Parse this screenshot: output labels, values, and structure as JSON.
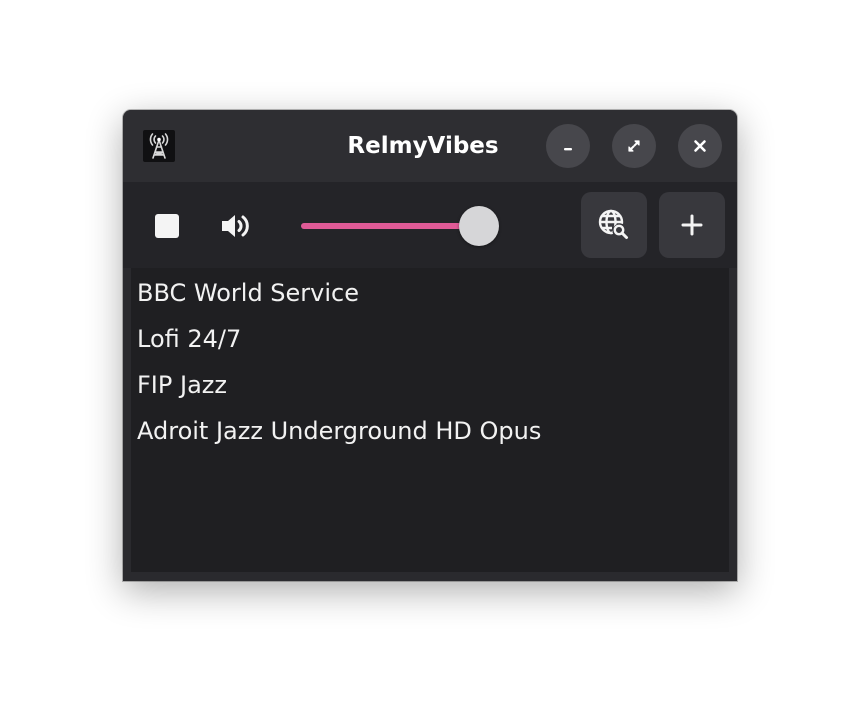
{
  "window": {
    "title": "RelmyVibes",
    "app_icon": "radio-tower-icon",
    "controls": [
      {
        "name": "minimize",
        "icon": "minimize-icon"
      },
      {
        "name": "maximize",
        "icon": "maximize-icon"
      },
      {
        "name": "close",
        "icon": "close-icon"
      }
    ]
  },
  "toolbar": {
    "stop_icon": "stop-icon",
    "volume_icon": "volume-high-icon",
    "volume_level": 0.92,
    "search_icon": "globe-search-icon",
    "add_icon": "plus-icon"
  },
  "stations": [
    "BBC World Service",
    "Lofi 24/7",
    "FIP Jazz",
    "Adroit Jazz Underground HD Opus"
  ],
  "colors": {
    "accent": "#e05a96",
    "knob": "#d6d6d8",
    "background": "#1f1f22"
  }
}
